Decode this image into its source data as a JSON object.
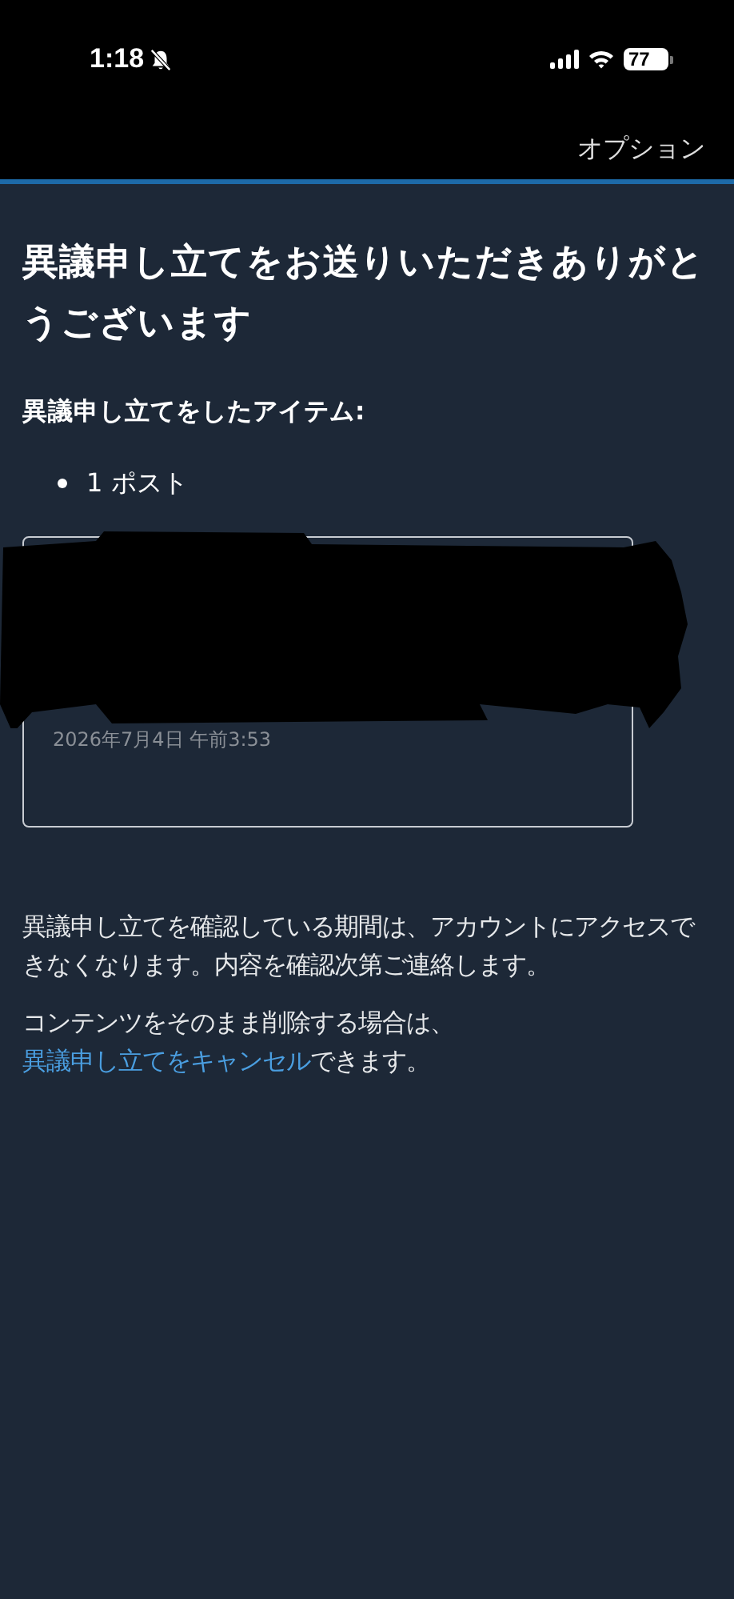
{
  "status_bar": {
    "time": "1:18",
    "battery": "77"
  },
  "header": {
    "action": "オプション"
  },
  "title": "異議申し立てをお送りいただきありがとうございます",
  "items_heading": "異議申し立てをしたアイテム:",
  "items": [
    "1 ポスト"
  ],
  "post_card": {
    "date": "2026年7月4日 午前3:53",
    "redacted": true
  },
  "paragraphs": [
    {
      "text": "異議申し立てを確認している期間は、アカウントにアクセスできなくなります。内容を確認次第ご連絡します。"
    },
    {
      "text": "コンテンツをそのまま削除する場合は、",
      "link": "異議申し立てをキャンセル",
      "after": "できます。"
    }
  ]
}
